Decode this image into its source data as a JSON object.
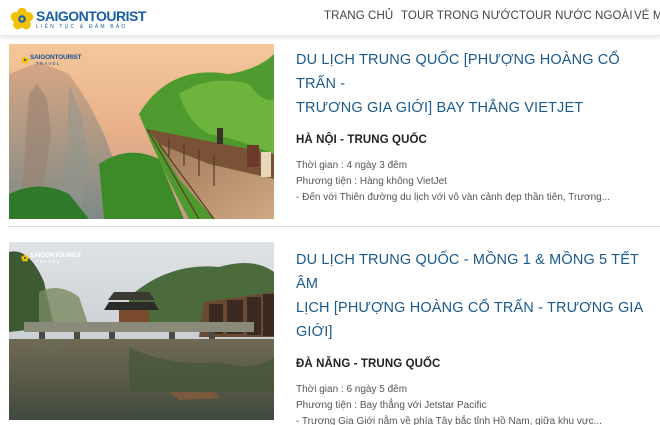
{
  "header": {
    "logo": {
      "word": "SAIGONTOURIST",
      "tagline": "LIÊN  TỤC  &  ĐẢM  BẢO"
    },
    "nav": [
      "TRANG CHỦ",
      "TOUR TRONG NƯỚC",
      "TOUR NƯỚC NGOÀI",
      "VÉ M"
    ]
  },
  "tours": [
    {
      "title_line1": "DU LỊCH TRUNG QUỐC [PHƯỢNG HOÀNG CỔ TRẤN -",
      "title_line2": "TRƯƠNG GIA GIỚI] BAY THẲNG VIETJET",
      "route": "HÀ NỘI - TRUNG QUỐC",
      "duration": "Thời gian : 4 ngày 3 đêm",
      "transport": "Phương tiện : Hàng không VietJet",
      "summary": "- Đến với Thiên đường du lịch với vô vàn cảnh đẹp thần tiên, Trương...",
      "image": {
        "watermark_word": "SAIGONTOURIST",
        "watermark_sub": "TRAVEL"
      }
    },
    {
      "title_line1": "DU LỊCH TRUNG QUỐC - MỒNG 1 & MỒNG 5 TẾT ÂM",
      "title_line2": "LỊCH [PHƯỢNG HOÀNG CỔ TRẤN - TRƯƠNG GIA GIỚI]",
      "route": "ĐÀ NẴNG - TRUNG QUỐC",
      "duration": "Thời gian : 6 ngày 5 đêm",
      "transport": "Phương tiện : Bay thẳng với Jetstar Pacific",
      "summary": "- Trương Gia Giới nằm về phía Tây bắc tỉnh Hồ Nam, giữa khu vực...",
      "image": {
        "watermark_word": "SAIGONTOURIST",
        "watermark_sub": "TRAVEL"
      }
    }
  ],
  "colors": {
    "brand": "#1a5ea8",
    "title": "#1a5a8c",
    "logo_flower": "#f2c200"
  }
}
